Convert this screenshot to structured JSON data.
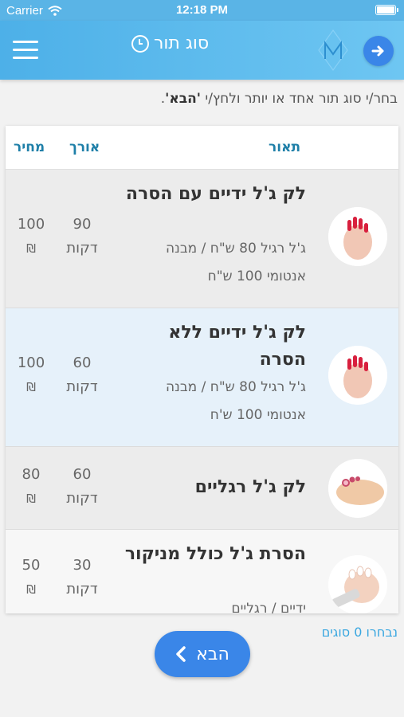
{
  "status_bar": {
    "carrier": "Carrier",
    "time": "12:18 PM"
  },
  "header": {
    "title": "סוג תור"
  },
  "instruction": {
    "text": "בחר/י סוג תור אחד או יותר ולחץ/י ",
    "bold": "'הבא'",
    "end": "."
  },
  "table": {
    "columns": {
      "description": "תאור",
      "length": "אורך",
      "price": "מחיר"
    },
    "rows": [
      {
        "title": "לק ג'ל ידיים עם הסרה",
        "desc": "ג'ל רגיל 80 ש\"ח / מבנה אנטומי 100 ש\"ח",
        "length_value": "90",
        "length_unit": "דקות",
        "price_value": "100",
        "currency": "₪",
        "background": "#ececec"
      },
      {
        "title": "לק ג'ל ידיים ללא הסרה",
        "desc": "ג'ל רגיל 80 ש\"ח / מבנה אנטומי 100 ש'ח",
        "length_value": "60",
        "length_unit": "דקות",
        "price_value": "100",
        "currency": "₪",
        "background": "#e6f1fa"
      },
      {
        "title": "לק ג'ל רגליים",
        "desc": "",
        "length_value": "60",
        "length_unit": "דקות",
        "price_value": "80",
        "currency": "₪",
        "background": "#ececec"
      },
      {
        "title": "הסרת ג'ל כולל מניקור",
        "desc": "ידיים / רגליים",
        "length_value": "30",
        "length_unit": "דקות",
        "price_value": "50",
        "currency": "₪",
        "background": "#f7f7f7"
      }
    ]
  },
  "footer": {
    "selected_count": "נבחרו 0 סוגים",
    "next_label": "הבא"
  },
  "colors": {
    "header": "#4db0e8",
    "accent_blue": "#3a86e8",
    "column_header": "#1e7fa8",
    "link_blue": "#3aa7e0"
  },
  "icons": [
    "wifi-icon",
    "battery-icon",
    "menu-icon",
    "clock-icon",
    "logo-m-icon",
    "arrow-right-icon",
    "chevron-left-icon"
  ]
}
